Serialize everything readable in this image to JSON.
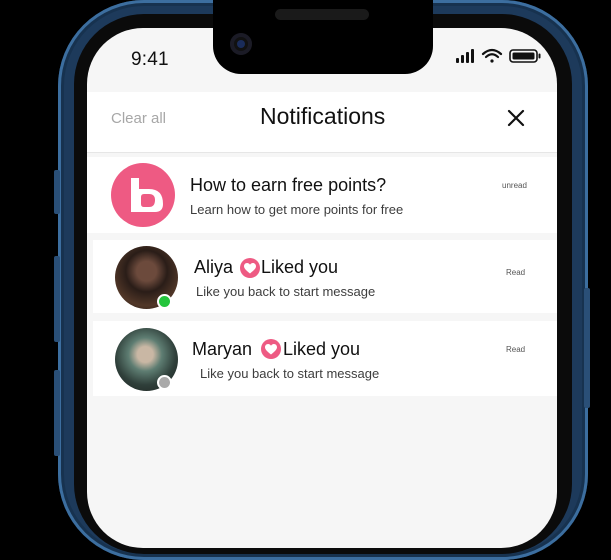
{
  "status_bar": {
    "time": "9:41"
  },
  "header": {
    "clear_all_label": "Clear all",
    "title": "Notifications"
  },
  "notifications": [
    {
      "title": "How to earn free points?",
      "subtitle": "Learn how to get more points for free",
      "status": "unread"
    },
    {
      "name": "Aliya",
      "action": "Liked you",
      "subtitle": "Like you back to start message",
      "status": "Read",
      "presence": "online"
    },
    {
      "name": "Maryan",
      "action": "Liked you",
      "subtitle": "Like you back to start message",
      "status": "Read",
      "presence": "offline"
    }
  ],
  "colors": {
    "accent": "#ee5a83",
    "online": "#24c43c",
    "offline": "#a9a9a9",
    "frame": "#1d3a5b"
  },
  "icons": [
    "cellular-signal-icon",
    "wifi-icon",
    "battery-icon",
    "close-icon",
    "heart-icon",
    "brand-logo-icon"
  ]
}
